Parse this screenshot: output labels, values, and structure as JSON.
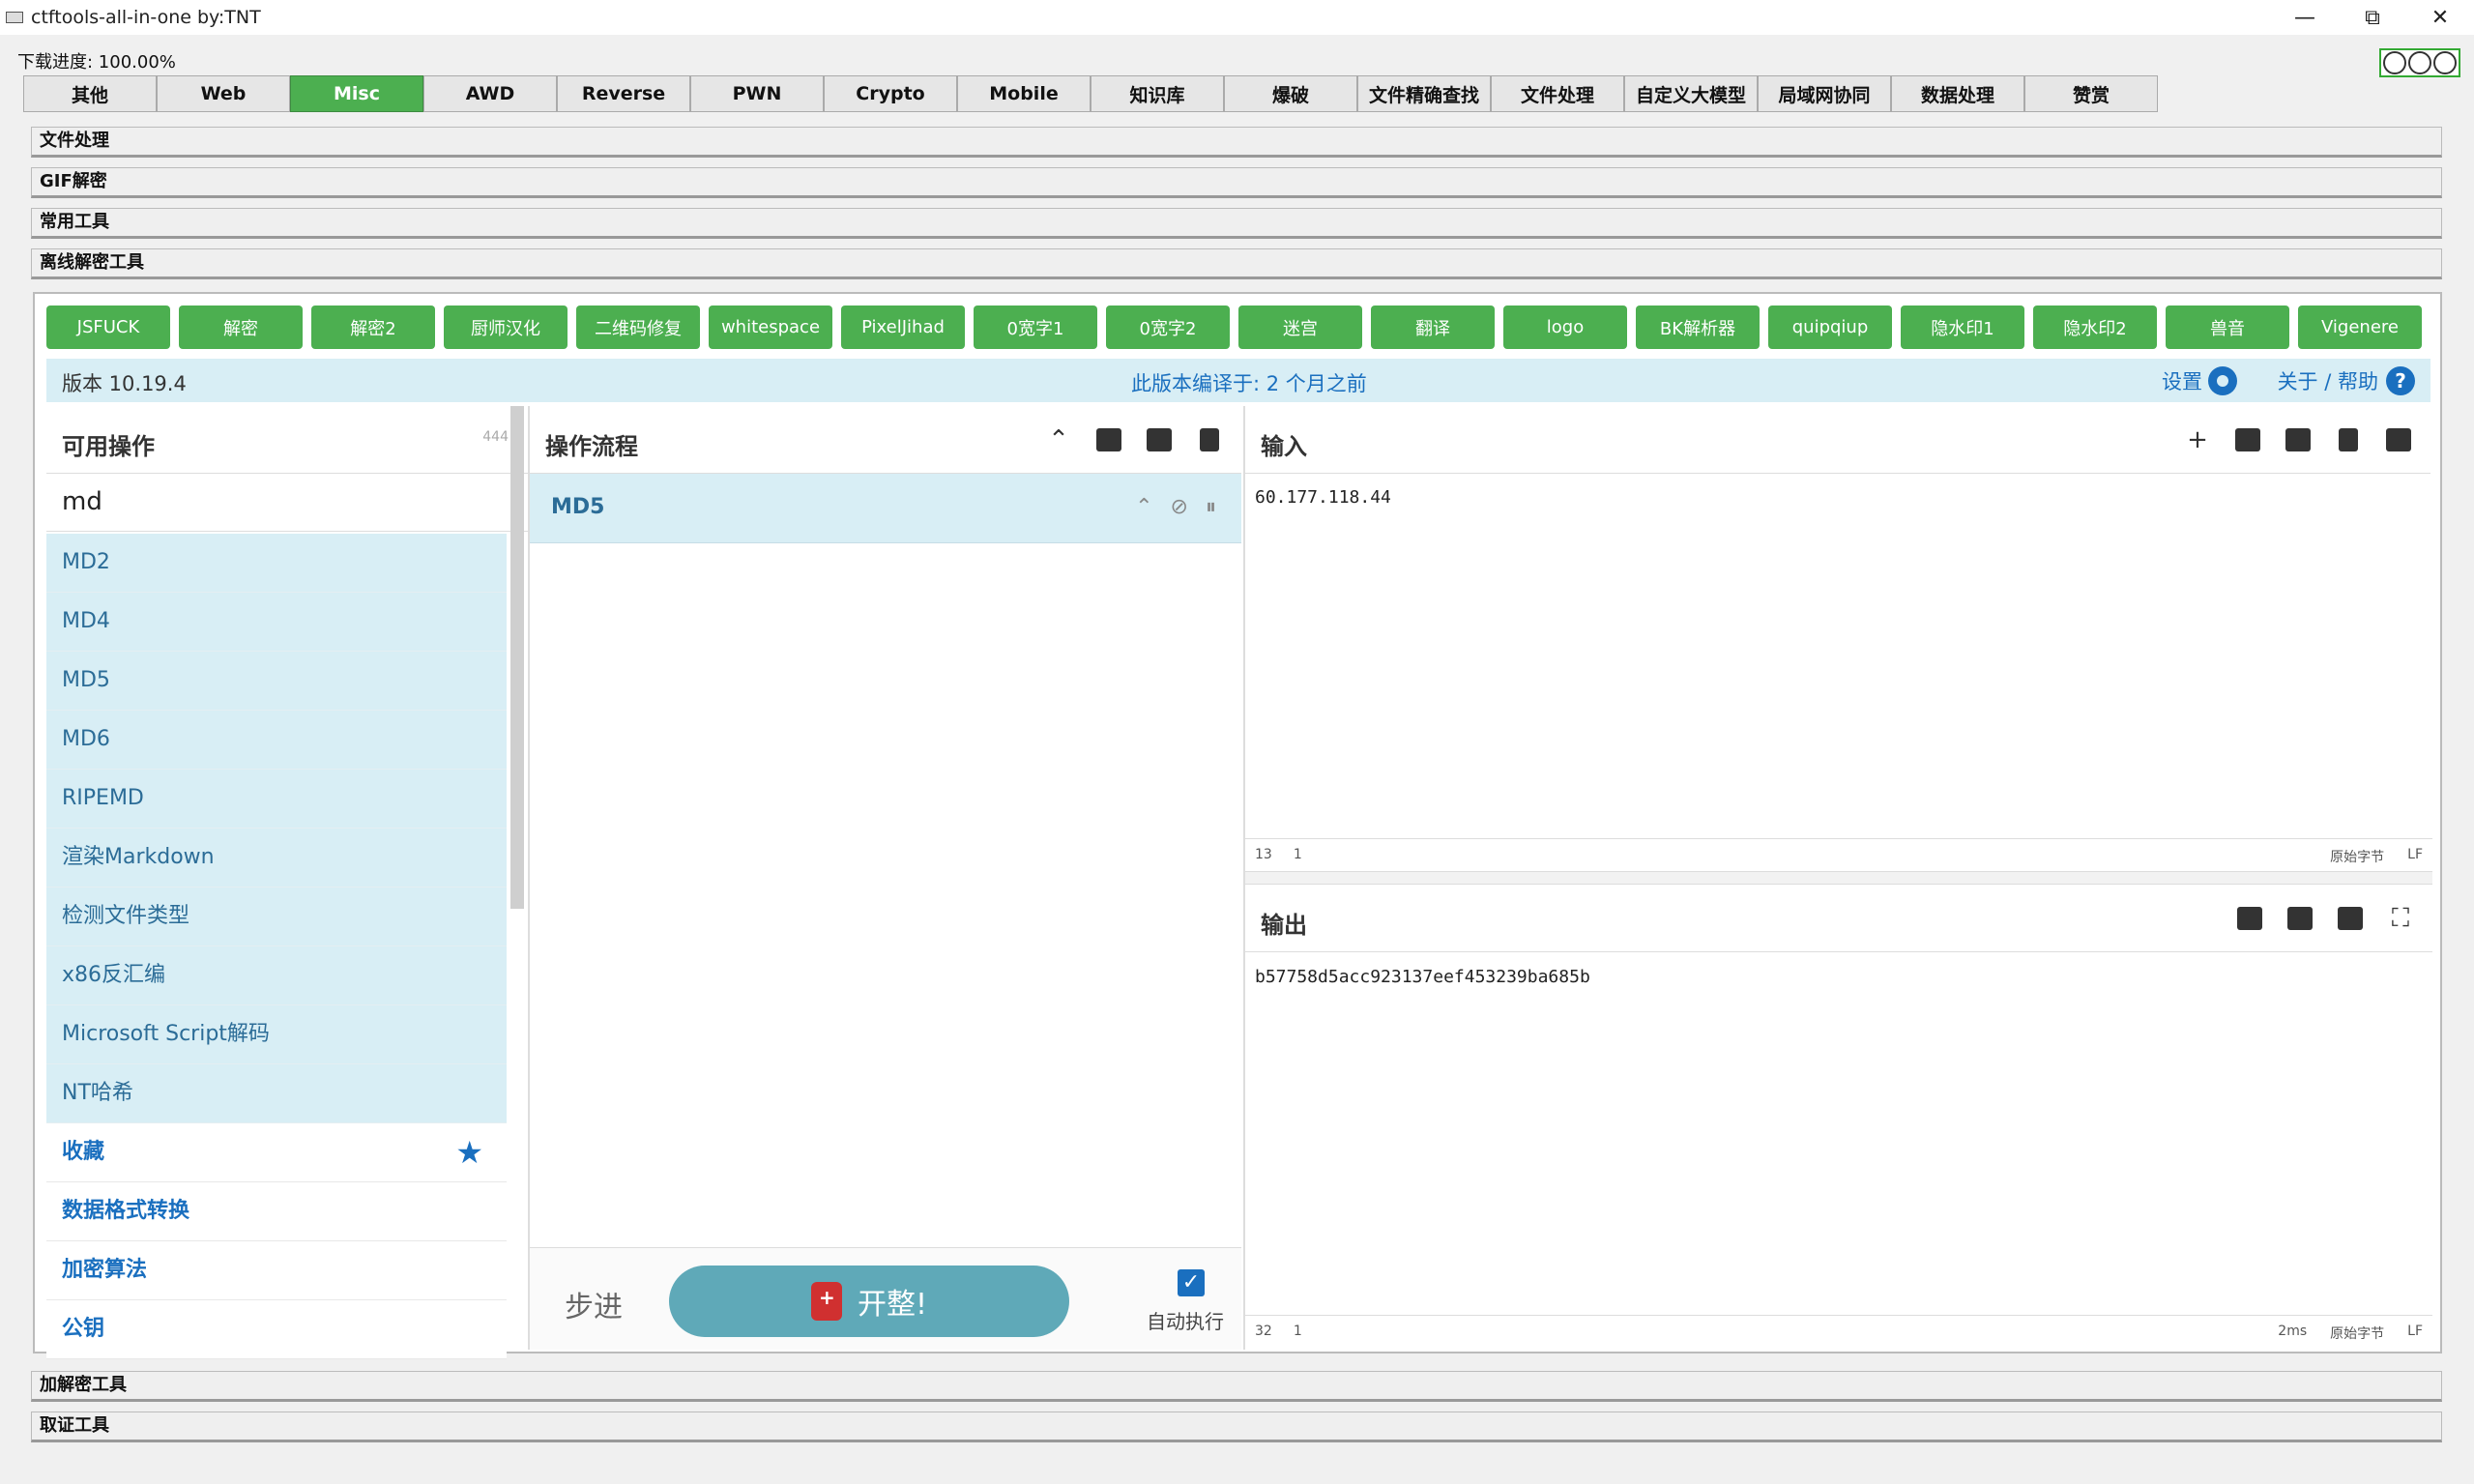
{
  "window": {
    "title": "ctftools-all-in-one   by:TNT",
    "minimize": "—",
    "restore": "⧉",
    "close": "✕"
  },
  "download_progress": "下载进度: 100.00%",
  "tabs": [
    "其他",
    "Web",
    "Misc",
    "AWD",
    "Reverse",
    "PWN",
    "Crypto",
    "Mobile",
    "知识库",
    "爆破",
    "文件精确查找",
    "文件处理",
    "自定义大模型",
    "局域网协同",
    "数据处理",
    "赞赏"
  ],
  "active_tab": "Misc",
  "sections_top": [
    "文件处理",
    "GIF解密",
    "常用工具",
    "离线解密工具"
  ],
  "sections_bottom": [
    "加解密工具",
    "取证工具"
  ],
  "tool_buttons": [
    "JSFUCK",
    "解密",
    "解密2",
    "厨师汉化",
    "二维码修复",
    "whitespace",
    "PixelJihad",
    "0宽字1",
    "0宽字2",
    "迷宫",
    "翻译",
    "logo",
    "BK解析器",
    "quipqiup",
    "隐水印1",
    "隐水印2",
    "兽音",
    "Vigenere"
  ],
  "infobar": {
    "version": "版本 10.19.4",
    "built": "此版本编译于:   2 个月之前",
    "settings": "设置",
    "help": "关于 / 帮助"
  },
  "operations": {
    "title": "可用操作",
    "count": "444",
    "search_value": "md",
    "results": [
      "MD2",
      "MD4",
      "MD5",
      "MD6",
      "RIPEMD",
      "渲染Markdown",
      "检测文件类型",
      "x86反汇编",
      "Microsoft Script解码",
      "NT哈希"
    ],
    "categories": [
      "收藏",
      "数据格式转换",
      "加密算法",
      "公钥"
    ]
  },
  "recipe": {
    "title": "操作流程",
    "op_name": "MD5",
    "step_label": "步进",
    "bake_label": "开整!",
    "auto_label": "自动执行",
    "auto_checked": true
  },
  "input": {
    "title": "输入",
    "value": "60.177.118.44",
    "length": "13",
    "lines": "1",
    "encoding": "原始字节",
    "eol": "LF"
  },
  "output": {
    "title": "输出",
    "value": "b57758d5acc923137eef453239ba685b",
    "length": "32",
    "lines": "1",
    "time": "2ms",
    "encoding": "原始字节",
    "eol": "LF"
  },
  "colors": {
    "active_green": "#4caf50",
    "highlight": "#d8eef5",
    "accent_blue": "#1a6fbf",
    "bake": "#5fa9b8"
  }
}
